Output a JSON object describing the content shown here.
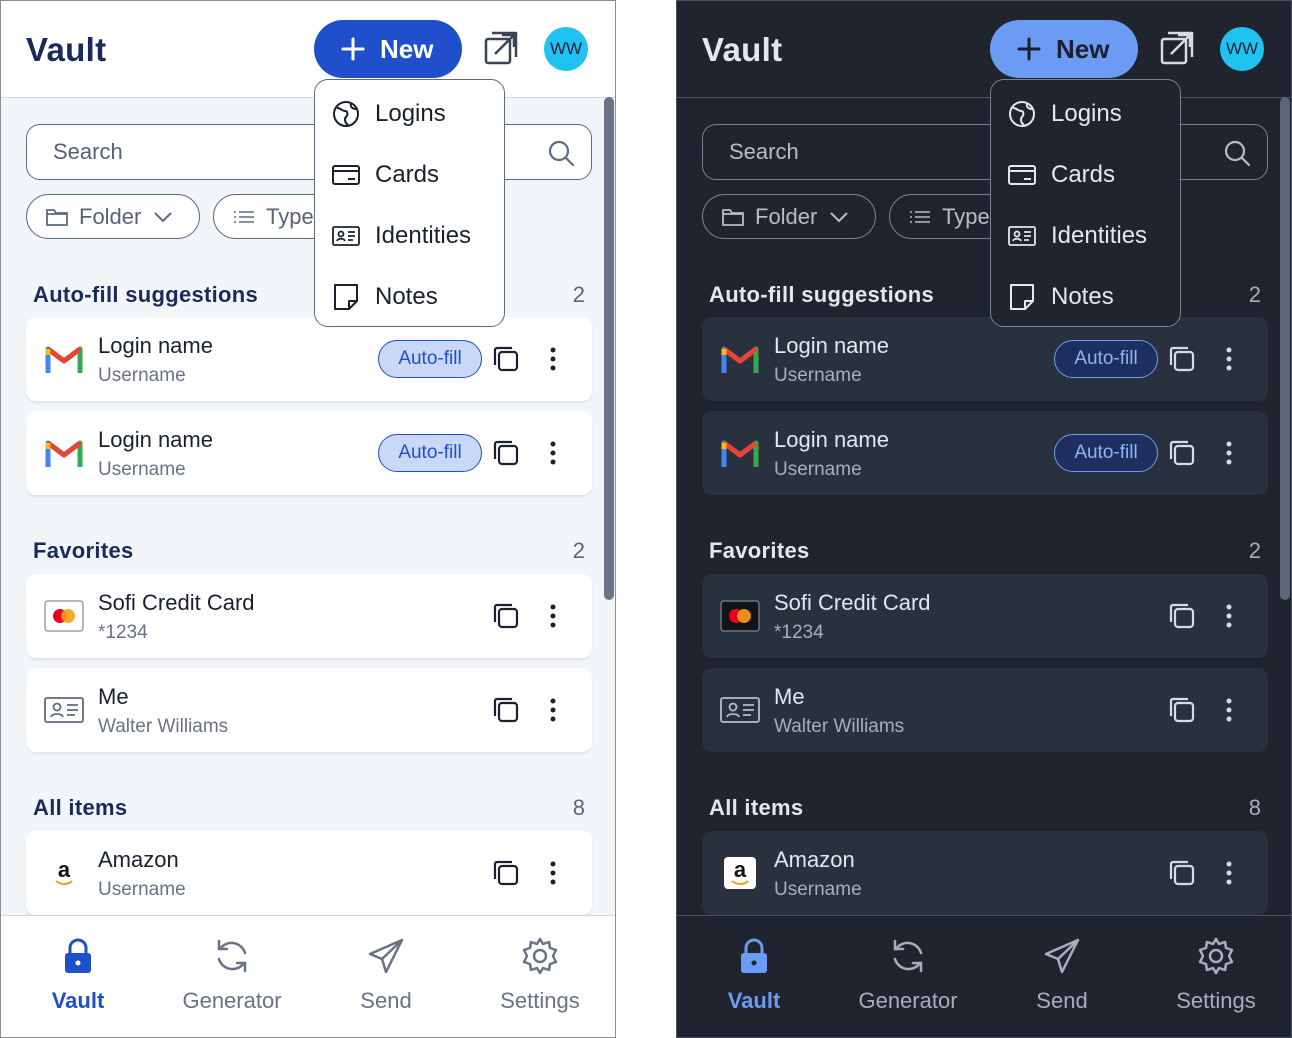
{
  "panels": {
    "light": {
      "title": "Vault",
      "new_label": "New",
      "avatar_initials": "WW",
      "search_placeholder": "Search",
      "filter_folder": "Folder",
      "filter_type": "Type",
      "menu": [
        "Logins",
        "Cards",
        "Identities",
        "Notes"
      ],
      "sections": {
        "autofill": {
          "title": "Auto-fill suggestions",
          "count": "2"
        },
        "favorites": {
          "title": "Favorites",
          "count": "2"
        },
        "all": {
          "title": "All items",
          "count": "8"
        }
      },
      "items": [
        {
          "name": "Login name",
          "sub": "Username",
          "action": "Auto-fill"
        },
        {
          "name": "Login name",
          "sub": "Username",
          "action": "Auto-fill"
        },
        {
          "name": "Sofi Credit Card",
          "sub": "*1234"
        },
        {
          "name": "Me",
          "sub": "Walter Williams"
        },
        {
          "name": "Amazon",
          "sub": "Username"
        }
      ],
      "nav": [
        "Vault",
        "Generator",
        "Send",
        "Settings"
      ]
    },
    "dark": {
      "title": "Vault",
      "new_label": "New",
      "avatar_initials": "WW",
      "search_placeholder": "Search",
      "filter_folder": "Folder",
      "filter_type": "Type",
      "menu": [
        "Logins",
        "Cards",
        "Identities",
        "Notes"
      ],
      "sections": {
        "autofill": {
          "title": "Auto-fill suggestions",
          "count": "2"
        },
        "favorites": {
          "title": "Favorites",
          "count": "2"
        },
        "all": {
          "title": "All items",
          "count": "8"
        }
      },
      "items": [
        {
          "name": "Login name",
          "sub": "Username",
          "action": "Auto-fill"
        },
        {
          "name": "Login name",
          "sub": "Username",
          "action": "Auto-fill"
        },
        {
          "name": "Sofi Credit Card",
          "sub": "*1234"
        },
        {
          "name": "Me",
          "sub": "Walter Williams"
        },
        {
          "name": "Amazon",
          "sub": "Username"
        }
      ],
      "nav": [
        "Vault",
        "Generator",
        "Send",
        "Settings"
      ]
    }
  },
  "colors": {
    "accent_light": "#1f4fcb",
    "accent_dark": "#6b9bf3",
    "avatar": "#1fc2f0",
    "dark_bg": "#1f242e"
  },
  "icons": {
    "items": [
      "gmail-icon",
      "gmail-icon",
      "credit-card-icon",
      "identity-card-icon",
      "amazon-icon"
    ],
    "menu": [
      "globe-icon",
      "card-icon",
      "identity-icon",
      "note-icon"
    ],
    "nav": [
      "lock-icon",
      "refresh-icon",
      "send-icon",
      "gear-icon"
    ]
  }
}
